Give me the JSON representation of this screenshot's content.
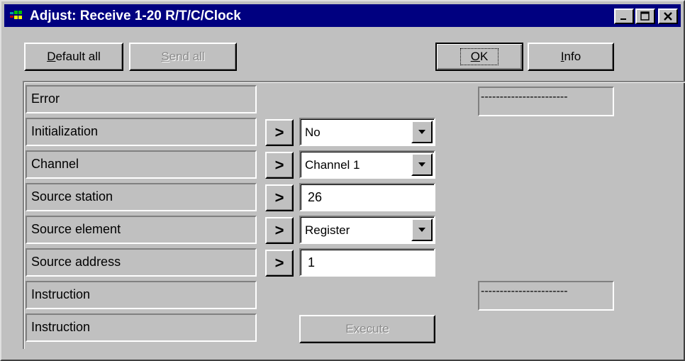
{
  "window": {
    "title": "Adjust: Receive 1-20 R/T/C/Clock",
    "minimize_icon": "minimize-icon",
    "maximize_icon": "maximize-icon",
    "close_icon": "close-icon"
  },
  "toolbar": {
    "default_all_accel": "D",
    "default_all_rest": "efault all",
    "send_all_accel": "S",
    "send_all_rest": "end all",
    "ok_accel": "O",
    "ok_rest": "K",
    "info_accel": "I",
    "info_rest": "nfo"
  },
  "rows": [
    {
      "label": "Error"
    },
    {
      "label": "Initialization",
      "control": "combo",
      "value": "No"
    },
    {
      "label": "Channel",
      "control": "combo",
      "value": "Channel 1"
    },
    {
      "label": "Source station",
      "control": "text",
      "value": "26"
    },
    {
      "label": "Source element",
      "control": "combo",
      "value": "Register"
    },
    {
      "label": "Source address",
      "control": "text",
      "value": "1"
    },
    {
      "label": "Instruction"
    },
    {
      "label": "Instruction"
    }
  ],
  "send_glyph": ">",
  "error_status": "-----------------------",
  "instruction_status": "-----------------------",
  "execute_label": "Execute",
  "colors": {
    "titlebar": "#000080",
    "face": "#c0c0c0",
    "disabled_text": "#8a8a8a"
  }
}
